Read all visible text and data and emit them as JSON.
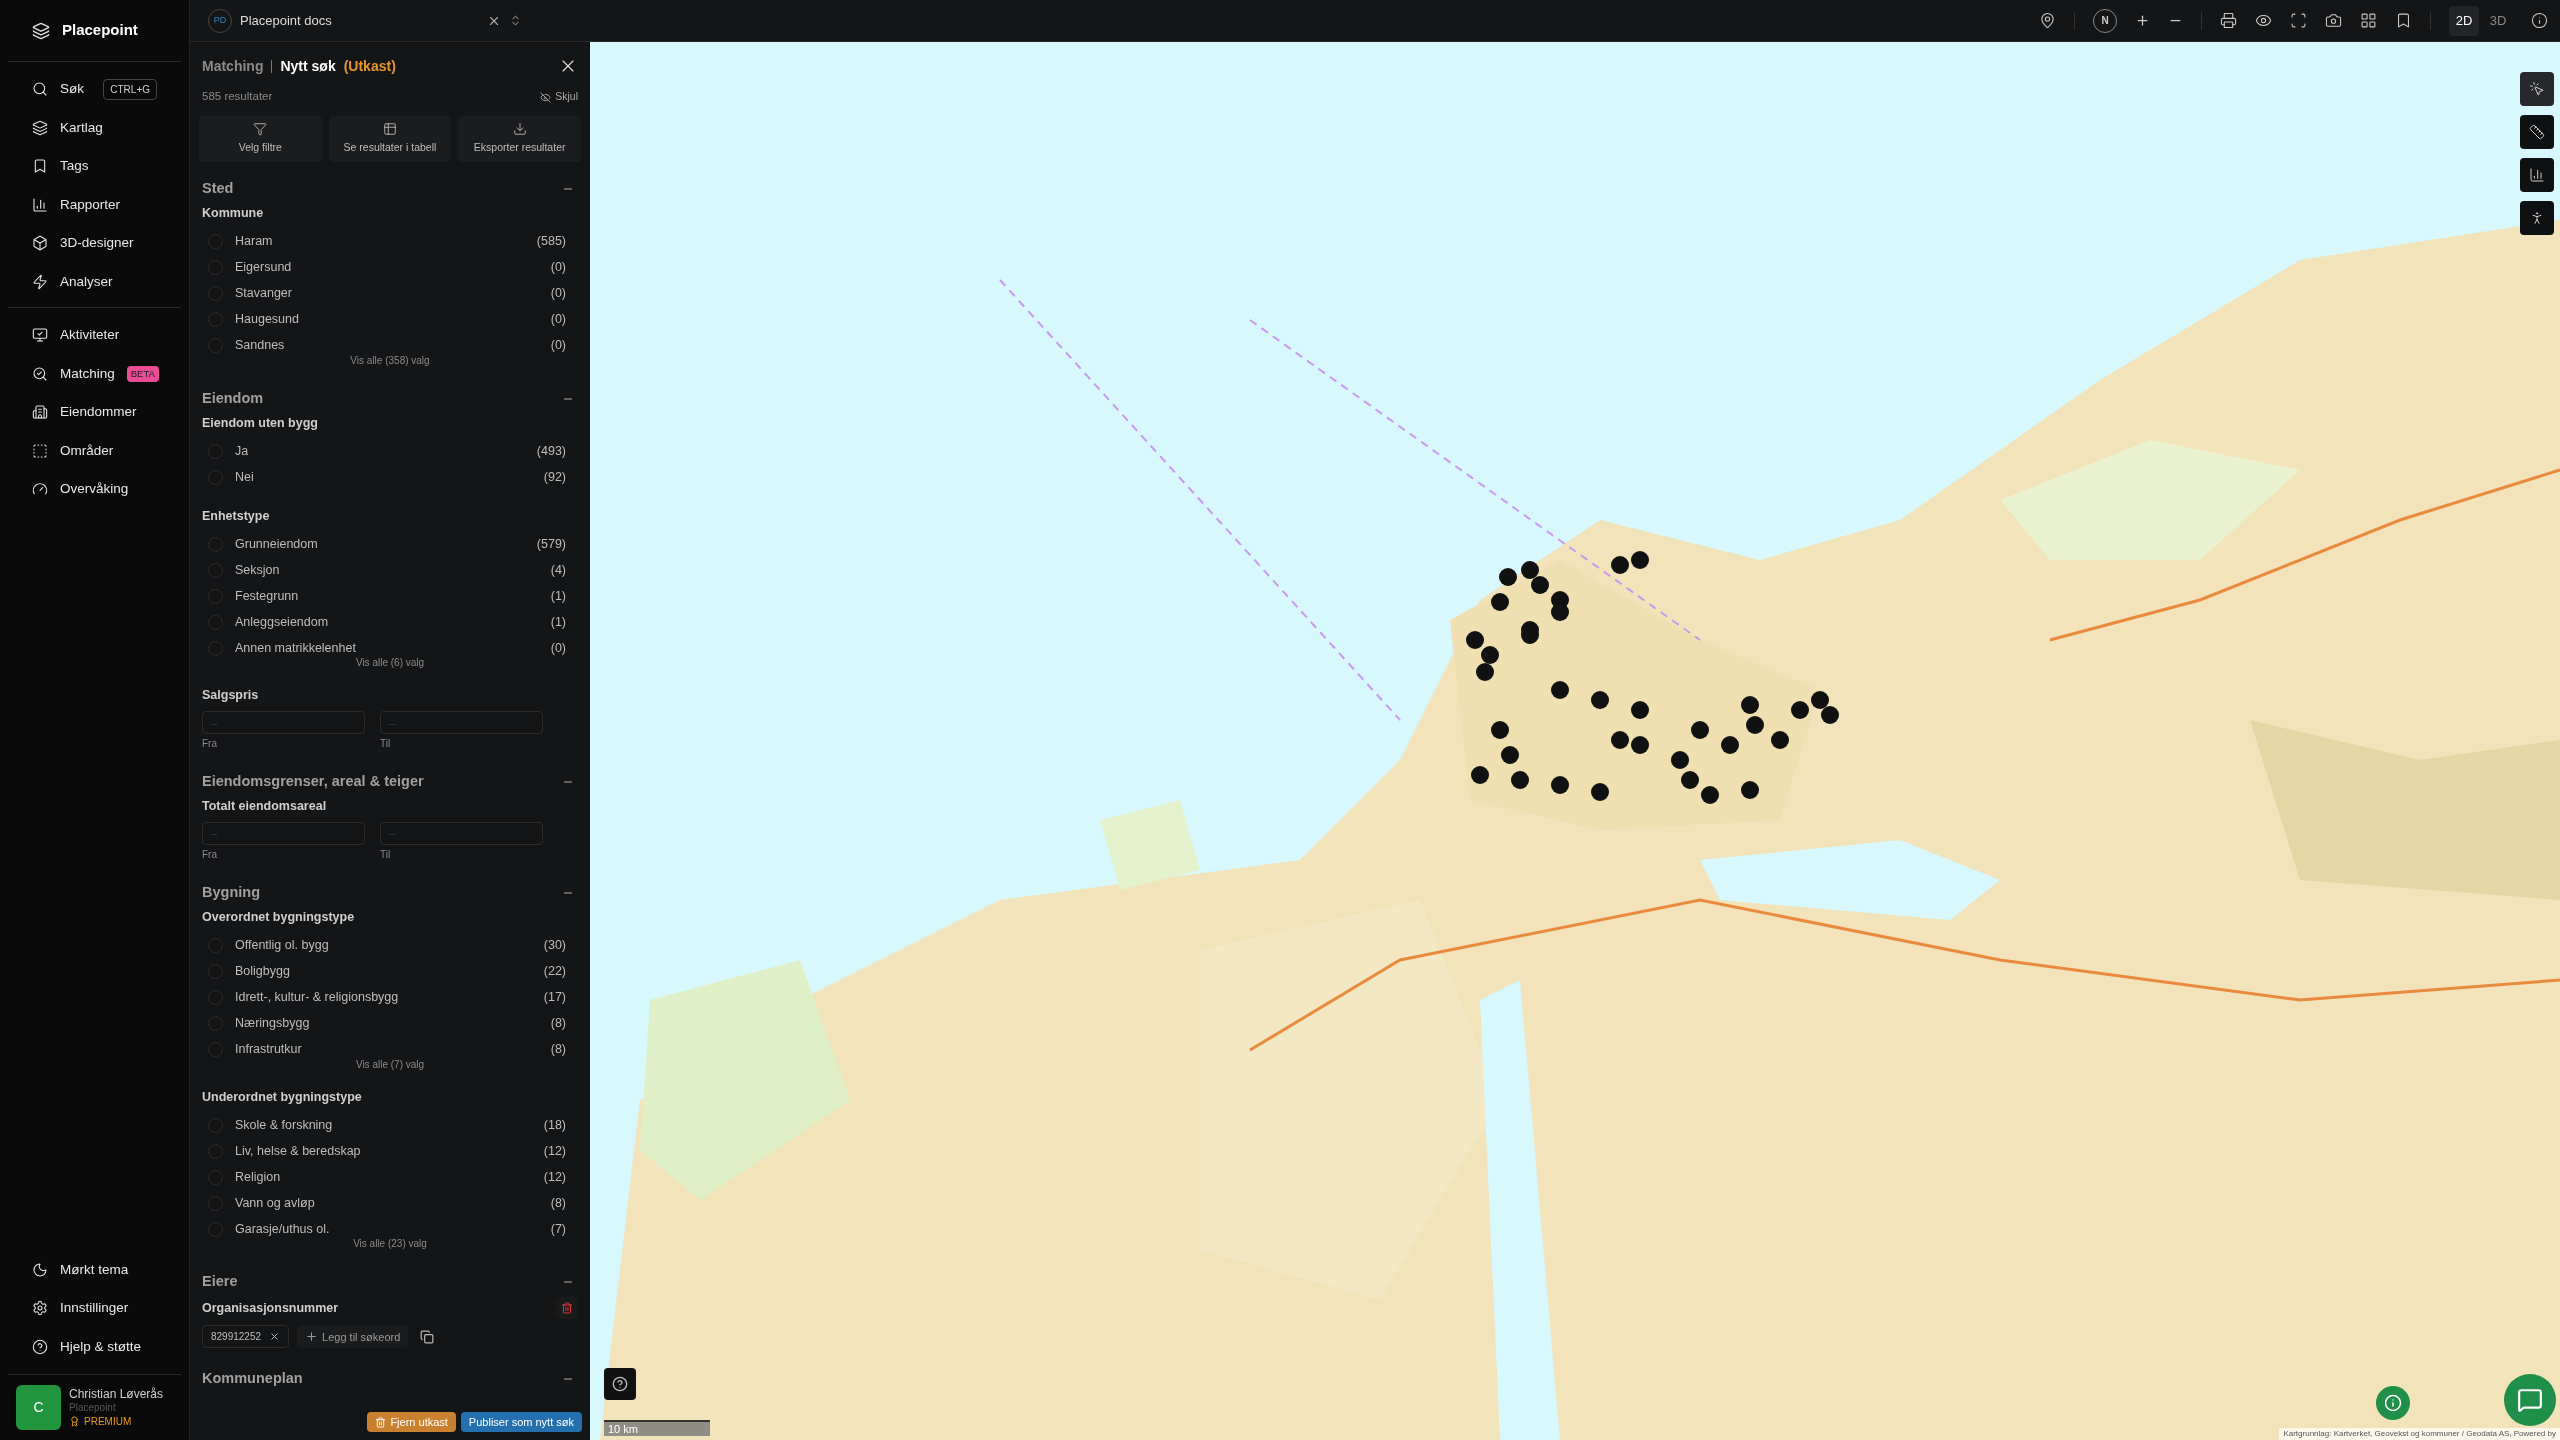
{
  "sidebar": {
    "brand": "Placepoint",
    "groups": [
      [
        {
          "kind": "search",
          "label": "Søk",
          "shortcut": "CTRL+G"
        },
        {
          "kind": "layers",
          "label": "Kartlag"
        },
        {
          "kind": "bookmark",
          "label": "Tags"
        },
        {
          "kind": "chart",
          "label": "Rapporter"
        },
        {
          "kind": "cube",
          "label": "3D-designer"
        },
        {
          "kind": "bolt",
          "label": "Analyser"
        }
      ],
      [
        {
          "kind": "activity",
          "label": "Aktiviteter"
        },
        {
          "kind": "match",
          "label": "Matching",
          "badge": "BETA"
        },
        {
          "kind": "building",
          "label": "Eiendommer"
        },
        {
          "kind": "area",
          "label": "Områder"
        },
        {
          "kind": "gauge",
          "label": "Overvåking"
        }
      ]
    ],
    "bottom": [
      {
        "kind": "moon",
        "label": "Mørkt tema"
      },
      {
        "kind": "gear",
        "label": "Innstillinger"
      },
      {
        "kind": "help",
        "label": "Hjelp & støtte"
      }
    ],
    "user": {
      "initial": "C",
      "name": "Christian Løverås",
      "org": "Placepoint",
      "plan": "PREMIUM"
    }
  },
  "workspace": {
    "initials": "PD",
    "name": "Placepoint docs"
  },
  "panel": {
    "breadcrumb": "Matching",
    "title": "Nytt søk",
    "status": "(Utkast)",
    "results": "585 resultater",
    "hide": "Skjul",
    "actions": [
      {
        "kind": "filter",
        "label": "Velg filtre"
      },
      {
        "kind": "table",
        "label": "Se resultater i tabell"
      },
      {
        "kind": "download",
        "label": "Eksporter resultater"
      }
    ],
    "sections": [
      {
        "title": "Sted",
        "expanded": true,
        "groups": [
          {
            "kind": "checklist",
            "title": "Kommune",
            "more": "Vis alle (358) valg",
            "options": [
              {
                "label": "Haram",
                "count": "(585)",
                "checked": false
              },
              {
                "label": "Eigersund",
                "count": "(0)",
                "checked": false
              },
              {
                "label": "Stavanger",
                "count": "(0)",
                "checked": false
              },
              {
                "label": "Haugesund",
                "count": "(0)",
                "checked": false
              },
              {
                "label": "Sandnes",
                "count": "(0)",
                "checked": false
              }
            ]
          }
        ]
      },
      {
        "title": "Eiendom",
        "expanded": true,
        "groups": [
          {
            "kind": "checklist",
            "title": "Eiendom uten bygg",
            "options": [
              {
                "label": "Ja",
                "count": "(493)",
                "checked": false
              },
              {
                "label": "Nei",
                "count": "(92)",
                "checked": false
              }
            ]
          },
          {
            "kind": "checklist",
            "title": "Enhetstype",
            "more": "Vis alle (6) valg",
            "options": [
              {
                "label": "Grunneiendom",
                "count": "(579)",
                "checked": false
              },
              {
                "label": "Seksjon",
                "count": "(4)",
                "checked": false
              },
              {
                "label": "Festegrunn",
                "count": "(1)",
                "checked": false
              },
              {
                "label": "Anleggseiendom",
                "count": "(1)",
                "checked": false
              },
              {
                "label": "Annen matrikkelenhet",
                "count": "(0)",
                "checked": false
              }
            ]
          },
          {
            "kind": "range",
            "title": "Salgspris",
            "fields": [
              {
                "placeholder": "–",
                "caption": "Fra"
              },
              {
                "placeholder": "–",
                "caption": "Til"
              }
            ]
          }
        ]
      },
      {
        "title": "Eiendomsgrenser, areal & teiger",
        "expanded": true,
        "groups": [
          {
            "kind": "range",
            "title": "Totalt eiendomsareal",
            "fields": [
              {
                "placeholder": "–",
                "caption": "Fra"
              },
              {
                "placeholder": "–",
                "caption": "Til"
              }
            ]
          }
        ]
      },
      {
        "title": "Bygning",
        "expanded": true,
        "groups": [
          {
            "kind": "checklist",
            "title": "Overordnet bygningstype",
            "more": "Vis alle (7) valg",
            "options": [
              {
                "label": "Offentlig ol. bygg",
                "count": "(30)",
                "checked": false
              },
              {
                "label": "Boligbygg",
                "count": "(22)",
                "checked": false
              },
              {
                "label": "Idrett-, kultur- & religionsbygg",
                "count": "(17)",
                "checked": false
              },
              {
                "label": "Næringsbygg",
                "count": "(8)",
                "checked": false
              },
              {
                "label": "Infrastrutkur",
                "count": "(8)",
                "checked": false
              }
            ]
          },
          {
            "kind": "checklist",
            "title": "Underordnet bygningstype",
            "more": "Vis alle (23) valg",
            "options": [
              {
                "label": "Skole & forskning",
                "count": "(18)",
                "checked": false
              },
              {
                "label": "Liv, helse & beredskap",
                "count": "(12)",
                "checked": false
              },
              {
                "label": "Religion",
                "count": "(12)",
                "checked": false
              },
              {
                "label": "Vann og avløp",
                "count": "(8)",
                "checked": false
              },
              {
                "label": "Garasje/uthus ol.",
                "count": "(7)",
                "checked": false
              }
            ]
          }
        ]
      },
      {
        "title": "Eiere",
        "expanded": true,
        "groups": [
          {
            "kind": "tags",
            "title": "Organisasjonsnummer",
            "tags": [
              "829912252"
            ],
            "add": "Legg til søkeord"
          }
        ]
      },
      {
        "title": "Kommuneplan",
        "expanded": true
      }
    ],
    "footer": [
      {
        "kind": "danger",
        "label": "Fjern utkast"
      },
      {
        "kind": "primary",
        "label": "Publiser som nytt søk"
      }
    ]
  },
  "map": {
    "compass": "N",
    "view_modes": [
      {
        "label": "2D",
        "selected": true
      },
      {
        "label": "3D",
        "selected": false
      }
    ],
    "scale": "10 km",
    "attribution": "Kartgrunnlag: Kartverket, Geovekst og kommuner / Geodata AS, Powered by"
  }
}
